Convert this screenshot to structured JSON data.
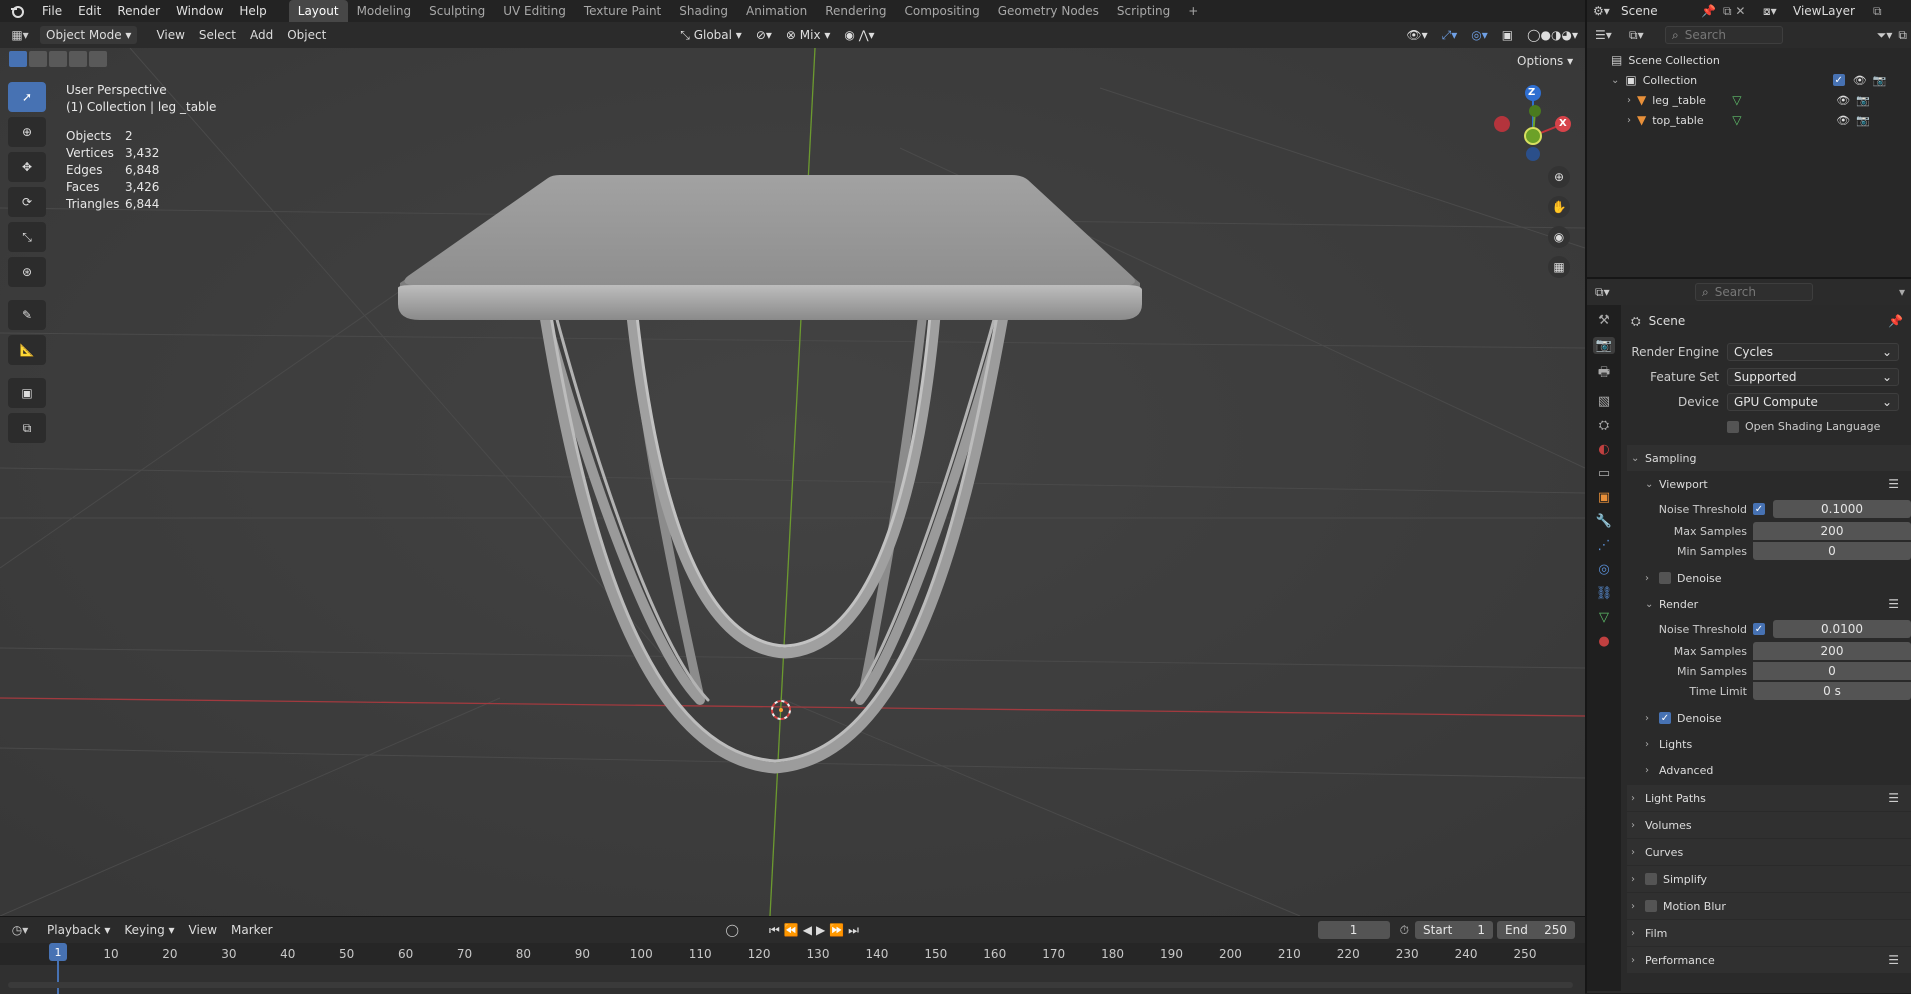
{
  "topbar": {
    "menus": [
      "File",
      "Edit",
      "Render",
      "Window",
      "Help"
    ],
    "workspaces": [
      "Layout",
      "Modeling",
      "Sculpting",
      "UV Editing",
      "Texture Paint",
      "Shading",
      "Animation",
      "Rendering",
      "Compositing",
      "Geometry Nodes",
      "Scripting"
    ],
    "active_workspace": "Layout",
    "add_tab": "+",
    "scene_name": "Scene",
    "view_layer": "ViewLayer"
  },
  "viewport_header": {
    "mode": "Object Mode",
    "menus": [
      "View",
      "Select",
      "Add",
      "Object"
    ],
    "orientation": "Global",
    "snap": "Mix",
    "options_label": "Options"
  },
  "overlay": {
    "perspective": "User Perspective",
    "collection_line": "(1) Collection | leg _table",
    "stats": [
      {
        "label": "Objects",
        "value": "2"
      },
      {
        "label": "Vertices",
        "value": "3,432"
      },
      {
        "label": "Edges",
        "value": "6,848"
      },
      {
        "label": "Faces",
        "value": "3,426"
      },
      {
        "label": "Triangles",
        "value": "6,844"
      }
    ]
  },
  "gizmo": {
    "z": "Z",
    "x": "X"
  },
  "outliner": {
    "search_placeholder": "Search",
    "root": "Scene Collection",
    "collection": "Collection",
    "objects": [
      "leg _table",
      "top_table"
    ]
  },
  "properties": {
    "search_placeholder": "Search",
    "context": "Scene",
    "render_engine_label": "Render Engine",
    "render_engine": "Cycles",
    "feature_set_label": "Feature Set",
    "feature_set": "Supported",
    "device_label": "Device",
    "device": "GPU Compute",
    "osl_label": "Open Shading Language",
    "sampling": "Sampling",
    "viewport": "Viewport",
    "noise_threshold_label": "Noise Threshold",
    "vp_noise_threshold": "0.1000",
    "max_samples_label": "Max Samples",
    "vp_max_samples": "200",
    "min_samples_label": "Min Samples",
    "vp_min_samples": "0",
    "denoise_label": "Denoise",
    "render": "Render",
    "r_noise_threshold": "0.0100",
    "r_max_samples": "200",
    "r_min_samples": "0",
    "time_limit_label": "Time Limit",
    "r_time_limit": "0 s",
    "lights": "Lights",
    "advanced": "Advanced",
    "panels": [
      "Light Paths",
      "Volumes",
      "Curves",
      "Simplify",
      "Motion Blur",
      "Film",
      "Performance"
    ]
  },
  "timeline": {
    "menus": [
      "Playback",
      "Keying",
      "View",
      "Marker"
    ],
    "current_frame": "1",
    "start_label": "Start",
    "start": "1",
    "end_label": "End",
    "end": "250",
    "ticks": [
      "1",
      "10",
      "20",
      "30",
      "40",
      "50",
      "60",
      "70",
      "80",
      "90",
      "100",
      "110",
      "120",
      "130",
      "140",
      "150",
      "160",
      "170",
      "180",
      "190",
      "200",
      "210",
      "220",
      "230",
      "240",
      "250"
    ]
  },
  "colors": {
    "accent": "#4772b3",
    "x_axis": "#c0343c",
    "y_axis": "#6ca128",
    "z_axis": "#2f6fd1"
  }
}
